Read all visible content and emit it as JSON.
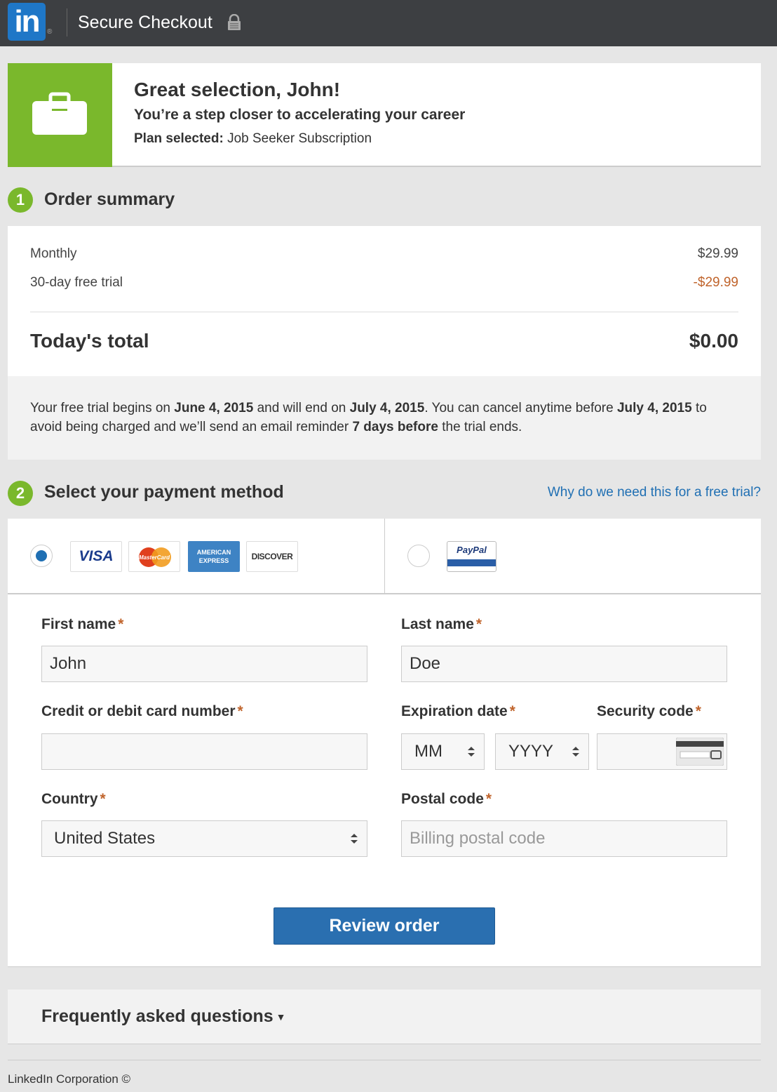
{
  "header": {
    "logo_text": "in",
    "logo_reg": "®",
    "title": "Secure Checkout"
  },
  "hero": {
    "title": "Great selection, John!",
    "subtitle": "You’re a step closer to accelerating your career",
    "plan_label": "Plan selected:",
    "plan_value": "Job Seeker Subscription"
  },
  "order_summary": {
    "step": "1",
    "title": "Order summary",
    "rows": [
      {
        "label": "Monthly",
        "value": "$29.99"
      },
      {
        "label": "30-day free trial",
        "value": "-$29.99"
      }
    ],
    "total_label": "Today's total",
    "total_value": "$0.00",
    "note": {
      "t1": "Your free trial begins on ",
      "start": "June 4, 2015",
      "t2": " and will end on ",
      "end": "July 4, 2015",
      "t3": ". You can cancel anytime before ",
      "cancel_by": "July 4, 2015",
      "t4": " to avoid being charged and we’ll send an email reminder ",
      "reminder": "7 days before",
      "t5": " the trial ends."
    }
  },
  "payment": {
    "step": "2",
    "title": "Select your payment method",
    "why_link": "Why do we need this for a free trial?",
    "card_logos": {
      "visa": "VISA",
      "mastercard": "MasterCard",
      "amex": "AMERICAN EXPRESS",
      "discover": "DISCOVER"
    },
    "paypal_logo": "PayPal",
    "selected_method": "card",
    "required_mark": "*",
    "fields": {
      "first_name": {
        "label": "First name",
        "value": "John"
      },
      "last_name": {
        "label": "Last name",
        "value": "Doe"
      },
      "card_number": {
        "label": "Credit or debit card number",
        "value": ""
      },
      "expiration": {
        "label": "Expiration date",
        "month": "MM",
        "year": "YYYY"
      },
      "security_code": {
        "label": "Security code",
        "value": ""
      },
      "country": {
        "label": "Country",
        "value": "United States"
      },
      "postal_code": {
        "label": "Postal code",
        "placeholder": "Billing postal code"
      }
    },
    "submit_label": "Review order"
  },
  "faq": {
    "title": "Frequently asked questions",
    "caret": "▼"
  },
  "footer": {
    "text": "LinkedIn Corporation ©"
  },
  "colors": {
    "brand_blue": "#1f77c7",
    "accent_green": "#7ab82c",
    "link_blue": "#1f6fb3",
    "discount_orange": "#c0642c",
    "button_blue": "#2a6fb0",
    "topbar": "#3d3f42"
  },
  "icons": [
    "lock-icon",
    "briefcase-icon",
    "select-arrows-icon",
    "card-back-icon",
    "caret-down-icon"
  ]
}
